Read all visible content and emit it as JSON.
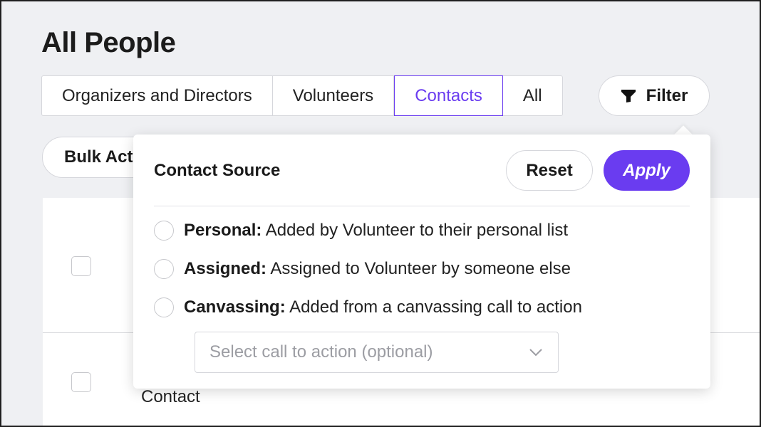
{
  "page": {
    "title": "All People"
  },
  "tabs": [
    {
      "label": "Organizers and Directors"
    },
    {
      "label": "Volunteers"
    },
    {
      "label": "Contacts",
      "active": true
    },
    {
      "label": "All"
    }
  ],
  "filter": {
    "label": "Filter",
    "icon": "funnel-icon"
  },
  "bulk": {
    "label": "Bulk Acti"
  },
  "table": {
    "row2_text": "Contact"
  },
  "popover": {
    "title": "Contact Source",
    "reset_label": "Reset",
    "apply_label": "Apply",
    "options": [
      {
        "label": "Personal:",
        "desc": "Added by Volunteer to their personal list"
      },
      {
        "label": "Assigned:",
        "desc": "Assigned to Volunteer by someone else"
      },
      {
        "label": "Canvassing:",
        "desc": "Added from a canvassing call to action"
      }
    ],
    "select_placeholder": "Select call to action (optional)"
  },
  "colors": {
    "accent": "#6a3cf0",
    "background": "#eff0f3"
  }
}
